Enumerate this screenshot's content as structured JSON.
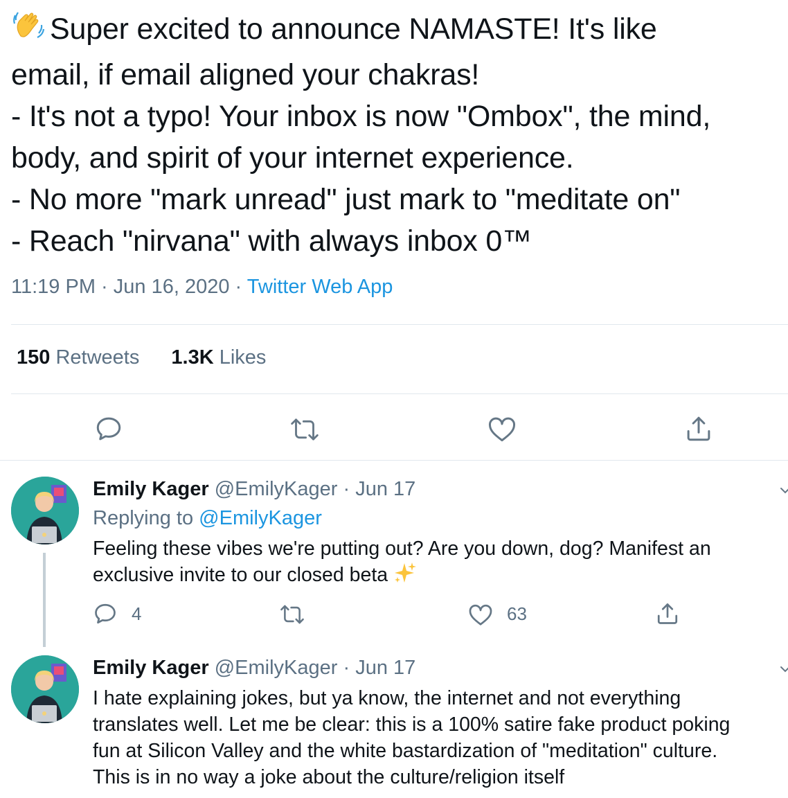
{
  "tweet": {
    "lines": [
      "Super excited to announce NAMASTE! It's like",
      "email, if email aligned your chakras!",
      "- It's not a typo! Your inbox is now \"Ombox\", the mind,",
      "body, and spirit of your internet experience.",
      "- No more \"mark unread\" just mark to \"meditate on\"",
      "- Reach \"nirvana\" with always inbox 0™"
    ],
    "time": "11:19 PM",
    "date": "Jun 16, 2020",
    "separator": "·",
    "app": "Twitter Web App",
    "retweets_count": "150",
    "retweets_label": "Retweets",
    "likes_count": "1.3K",
    "likes_label": "Likes"
  },
  "replies": [
    {
      "name": "Emily Kager",
      "handle": "@EmilyKager",
      "separator": "·",
      "date": "Jun 17",
      "replying_prefix": "Replying to",
      "replying_to": "@EmilyKager",
      "lines": [
        "Feeling these vibes we're putting out? Are you down, dog? Manifest an",
        "exclusive invite to our closed beta"
      ],
      "reply_count": "4",
      "like_count": "63"
    },
    {
      "name": "Emily Kager",
      "handle": "@EmilyKager",
      "separator": "·",
      "date": "Jun 17",
      "lines": [
        "I hate explaining jokes, but ya know, the internet and not everything",
        "translates well. Let me be clear: this is a 100% satire fake product poking",
        "fun at Silicon Valley and the white bastardization of \"meditation\" culture.",
        "This is in no way a joke about the culture/religion itself"
      ]
    }
  ],
  "icons": [
    "waving-hand-icon",
    "reply-icon",
    "retweet-icon",
    "like-icon",
    "share-icon",
    "sparkles-icon",
    "chevron-down-icon"
  ],
  "colors": {
    "link": "#1b95e0",
    "secondary": "#5b7083",
    "divider": "#e1e8ed",
    "icon": "#657786"
  }
}
